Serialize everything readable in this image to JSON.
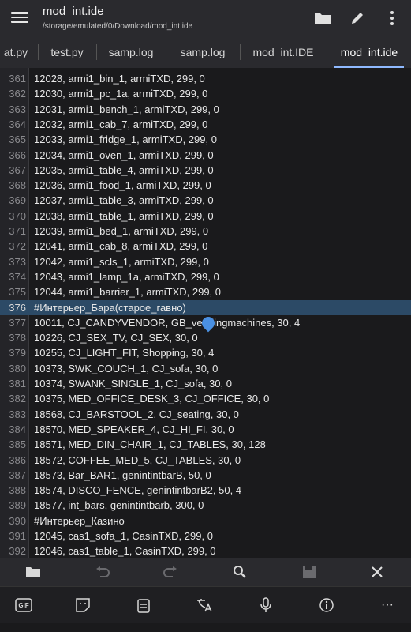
{
  "header": {
    "title": "mod_int.ide",
    "path": "/storage/emulated/0/Download/mod_int.ide",
    "icons": [
      "menu-icon",
      "folder-icon",
      "pencil-icon",
      "more-vert-icon"
    ]
  },
  "tabs": [
    "at.py",
    "test.py",
    "samp.log",
    "samp.log",
    "mod_int.IDE",
    "mod_int.ide"
  ],
  "active_tab": 5,
  "lines": [
    {
      "n": "361",
      "text": "12028, armi1_bin_1, armiTXD, 299, 0"
    },
    {
      "n": "362",
      "text": "12030, armi1_pc_1a, armiTXD, 299, 0"
    },
    {
      "n": "363",
      "text": "12031, armi1_bench_1, armiTXD, 299, 0"
    },
    {
      "n": "364",
      "text": "12032, armi1_cab_7, armiTXD, 299, 0"
    },
    {
      "n": "365",
      "text": "12033, armi1_fridge_1, armiTXD, 299, 0"
    },
    {
      "n": "366",
      "text": "12034, armi1_oven_1, armiTXD, 299, 0"
    },
    {
      "n": "367",
      "text": "12035, armi1_table_4, armiTXD, 299, 0"
    },
    {
      "n": "368",
      "text": "12036, armi1_food_1, armiTXD, 299, 0"
    },
    {
      "n": "369",
      "text": "12037, armi1_table_3, armiTXD, 299, 0"
    },
    {
      "n": "370",
      "text": "12038, armi1_table_1, armiTXD, 299, 0"
    },
    {
      "n": "371",
      "text": "12039, armi1_bed_1, armiTXD, 299, 0"
    },
    {
      "n": "372",
      "text": "12041, armi1_cab_8, armiTXD, 299, 0"
    },
    {
      "n": "373",
      "text": "12042, armi1_scls_1, armiTXD, 299, 0"
    },
    {
      "n": "374",
      "text": "12043, armi1_lamp_1a, armiTXD, 299, 0"
    },
    {
      "n": "375",
      "text": "12044, armi1_barrier_1, armiTXD, 299, 0"
    },
    {
      "n": "376",
      "text": "#Интерьер_Бара(старое_гавно)"
    },
    {
      "n": "377",
      "text": "10011, CJ_CANDYVENDOR, GB_vendingmachines, 30, 4"
    },
    {
      "n": "378",
      "text": "10226, CJ_SEX_TV, CJ_SEX, 30, 0"
    },
    {
      "n": "379",
      "text": "10255, CJ_LIGHT_FIT, Shopping, 30, 4"
    },
    {
      "n": "380",
      "text": "10373, SWK_COUCH_1, CJ_sofa, 30, 0"
    },
    {
      "n": "381",
      "text": "10374, SWANK_SINGLE_1, CJ_sofa, 30, 0"
    },
    {
      "n": "382",
      "text": "10375, MED_OFFICE_DESK_3, CJ_OFFICE, 30, 0"
    },
    {
      "n": "383",
      "text": "18568, CJ_BARSTOOL_2, CJ_seating, 30, 0"
    },
    {
      "n": "384",
      "text": "18570, MED_SPEAKER_4, CJ_HI_FI, 30, 0"
    },
    {
      "n": "385",
      "text": "18571, MED_DIN_CHAIR_1, CJ_TABLES, 30, 128"
    },
    {
      "n": "386",
      "text": "18572, COFFEE_MED_5, CJ_TABLES, 30, 0"
    },
    {
      "n": "387",
      "text": "18573, Bar_BAR1, genintintbarB, 50, 0"
    },
    {
      "n": "388",
      "text": "18574, DISCO_FENCE, genintintbarB2, 50, 4"
    },
    {
      "n": "389",
      "text": "18577, int_bars, genintintbarb, 300, 0"
    },
    {
      "n": "390",
      "text": "#Интерьер_Казино"
    },
    {
      "n": "391",
      "text": "12045, cas1_sofa_1, CasinTXD, 299, 0"
    },
    {
      "n": "392",
      "text": "12046, cas1_table_1, CasinTXD, 299, 0"
    }
  ],
  "highlighted_line": "376",
  "bottom_toolbar": [
    "folder-icon",
    "undo-icon",
    "redo-icon",
    "search-icon",
    "save-icon",
    "close-icon"
  ],
  "keyboard_toolbar": {
    "gif_label": "GIF",
    "icons": [
      "gif-icon",
      "sticker-icon",
      "clipboard-icon",
      "translate-icon",
      "mic-icon",
      "info-icon",
      "more-horiz-icon"
    ],
    "more_label": "···"
  },
  "colors": {
    "background": "#1a1a1c",
    "bar": "#2a2a2e",
    "highlight": "#2c4a66",
    "accent": "#8fb9ff",
    "cursor": "#4a90e2"
  }
}
